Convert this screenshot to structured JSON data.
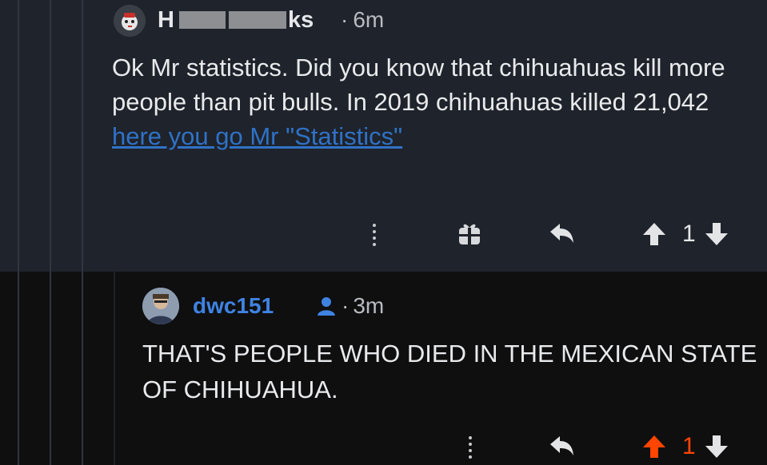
{
  "comments": [
    {
      "username_prefix": "H",
      "username_suffix": "ks",
      "separator": "·",
      "age": "6m",
      "text": "Ok Mr statistics. Did you know that chihuahuas kill more people than pit bulls. In 2019 chihuahuas killed 21,042",
      "link_text": "here you go Mr \"Statistics\"",
      "vote_count": "1",
      "upvoted": false
    },
    {
      "username": "dwc151",
      "separator": "·",
      "age": "3m",
      "text": "THAT'S PEOPLE WHO DIED IN THE MEXICAN STATE OF CHIHUAHUA.",
      "vote_count": "1",
      "upvoted": true
    }
  ],
  "colors": {
    "upvote_active": "#ff4500",
    "link": "#2f72c7",
    "username_op": "#3f83e2"
  },
  "icons": [
    "more-options-icon",
    "award-icon",
    "reply-icon",
    "upvote-icon",
    "downvote-icon",
    "op-user-icon"
  ]
}
